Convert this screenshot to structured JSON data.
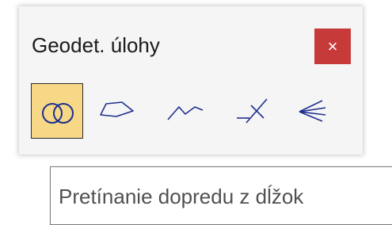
{
  "window": {
    "title": "Geodet. úlohy",
    "close_label": "×"
  },
  "toolbar": {
    "tools": [
      {
        "icon": "intersecting-circles-icon",
        "selected": true
      },
      {
        "icon": "polygon-icon",
        "selected": false
      },
      {
        "icon": "polyline-icon",
        "selected": false
      },
      {
        "icon": "crossing-lines-icon",
        "selected": false
      },
      {
        "icon": "resection-rays-icon",
        "selected": false
      }
    ]
  },
  "tooltip": {
    "text": "Pretínanie dopredu z dĺžok"
  },
  "colors": {
    "icon_stroke": "#1f2f8f",
    "selected_background": "#f6d887",
    "close_background": "#c73a3a"
  }
}
